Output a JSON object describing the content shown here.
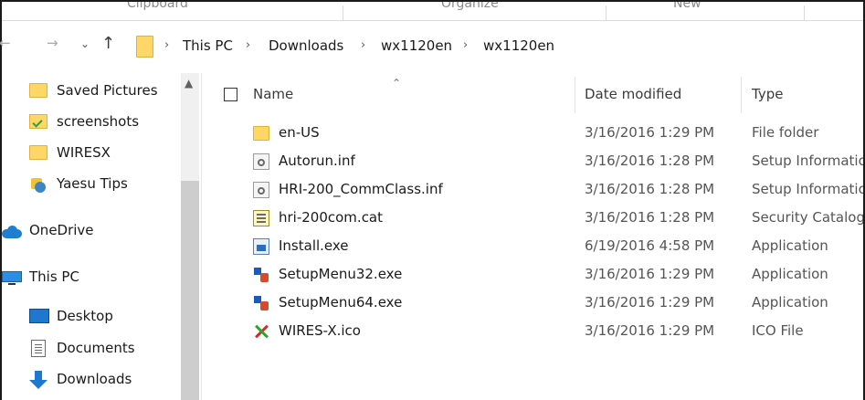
{
  "ribbon": {
    "groups": [
      "Clipboard",
      "Organize",
      "New"
    ]
  },
  "address": {
    "back_icon": "back-arrow-icon",
    "forward_icon": "forward-arrow-icon",
    "recent_icon": "chevron-down-icon",
    "up_icon": "up-arrow-icon",
    "breadcrumbs": [
      "This PC",
      "Downloads",
      "wx1120en",
      "wx1120en"
    ]
  },
  "nav_pane": {
    "items": [
      {
        "label": "Saved Pictures",
        "icon": "folder-icon"
      },
      {
        "label": "screenshots",
        "icon": "folder-check-icon"
      },
      {
        "label": "WIRESX",
        "icon": "folder-icon"
      },
      {
        "label": "Yaesu Tips",
        "icon": "shortcut-icon"
      },
      {
        "label": "OneDrive",
        "icon": "onedrive-cloud-icon"
      },
      {
        "label": "This PC",
        "icon": "computer-icon"
      },
      {
        "label": "Desktop",
        "icon": "desktop-icon"
      },
      {
        "label": "Documents",
        "icon": "documents-icon"
      },
      {
        "label": "Downloads",
        "icon": "downloads-icon"
      }
    ]
  },
  "file_list": {
    "columns": {
      "name": "Name",
      "date_modified": "Date modified",
      "type": "Type"
    },
    "rows": [
      {
        "name": "en-US",
        "date": "3/16/2016 1:29 PM",
        "type": "File folder",
        "icon": "folder-icon"
      },
      {
        "name": "Autorun.inf",
        "date": "3/16/2016 1:28 PM",
        "type": "Setup Information",
        "icon": "setup-info-icon"
      },
      {
        "name": "HRI-200_CommClass.inf",
        "date": "3/16/2016 1:28 PM",
        "type": "Setup Information",
        "icon": "setup-info-icon"
      },
      {
        "name": "hri-200com.cat",
        "date": "3/16/2016 1:28 PM",
        "type": "Security Catalog",
        "icon": "security-catalog-icon"
      },
      {
        "name": "Install.exe",
        "date": "6/19/2016 4:58 PM",
        "type": "Application",
        "icon": "application-icon"
      },
      {
        "name": "SetupMenu32.exe",
        "date": "3/16/2016 1:29 PM",
        "type": "Application",
        "icon": "setupmenu-app-icon"
      },
      {
        "name": "SetupMenu64.exe",
        "date": "3/16/2016 1:29 PM",
        "type": "Application",
        "icon": "setupmenu-app-icon"
      },
      {
        "name": "WIRES-X.ico",
        "date": "3/16/2016 1:29 PM",
        "type": "ICO File",
        "icon": "wires-x-ico-icon"
      }
    ]
  }
}
